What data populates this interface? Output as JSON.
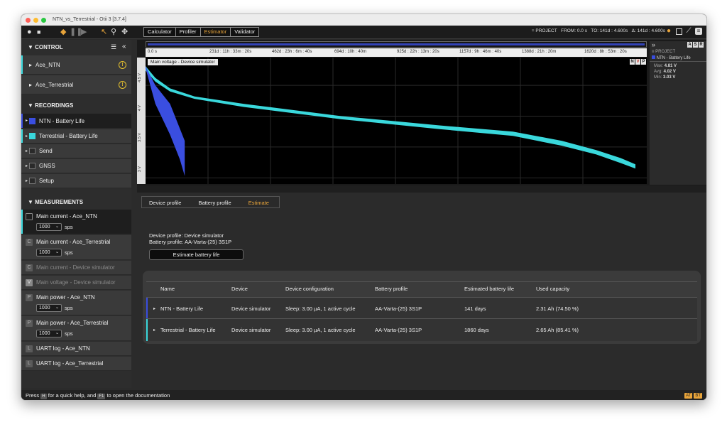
{
  "window": {
    "title": "NTN_vs_Terrestrial - Otii 3 [3.7.4]"
  },
  "toolbar": {
    "tabs": [
      "Calculator",
      "Profiler",
      "Estimator",
      "Validator"
    ],
    "active_tab": "Estimator",
    "project_label": "PROJECT",
    "from_label": "FROM: 0.0 s",
    "to_label": "TO: 141d : 4.600s",
    "delta_label": "Δ: 141d : 4.600s"
  },
  "sidebar": {
    "control_header": "CONTROL",
    "control_items": [
      {
        "label": "Ace_NTN",
        "status": "!"
      },
      {
        "label": "Ace_Terrestrial",
        "status": "!"
      }
    ],
    "recordings_header": "RECORDINGS",
    "recordings": [
      {
        "label": "NTN - Battery Life",
        "color": "#3a4ee0"
      },
      {
        "label": "Terrestrial - Battery Life",
        "color": "#3ad8dc"
      },
      {
        "label": "Send",
        "color": "#2a2a2a"
      },
      {
        "label": "GNSS",
        "color": "#2a2a2a"
      },
      {
        "label": "Setup",
        "color": "#2a2a2a"
      }
    ],
    "measurements_header": "MEASUREMENTS",
    "measurements": [
      {
        "letter": "",
        "label": "Main current - Ace_NTN",
        "sps": "1000",
        "unit": "sps"
      },
      {
        "letter": "C",
        "label": "Main current - Ace_Terrestrial",
        "sps": "1000",
        "unit": "sps"
      },
      {
        "letter": "C",
        "label": "Main current - Device simulator"
      },
      {
        "letter": "V",
        "label": "Main voltage - Device simulator"
      },
      {
        "letter": "P",
        "label": "Main power - Ace_NTN",
        "sps": "1000",
        "unit": "sps"
      },
      {
        "letter": "P",
        "label": "Main power - Ace_Terrestrial",
        "sps": "1000",
        "unit": "sps"
      },
      {
        "letter": "L",
        "label": "UART log - Ace_NTN"
      },
      {
        "letter": "L",
        "label": "UART log - Ace_Terrestrial"
      }
    ]
  },
  "graph": {
    "time_ticks": [
      "0.0 s",
      "231d : 11h : 33m : 20s",
      "462d : 23h : 6m : 40s",
      "694d : 10h : 40m",
      "925d : 22h : 13m : 20s",
      "1157d : 9h : 46m : 40s",
      "1388d : 21h : 20m",
      "1620d : 8h : 53m : 20s"
    ],
    "y_ticks": [
      "4.5 V",
      "4 V",
      "3.5 V",
      "3 V"
    ],
    "chart_label": "Main voltage - Device simulator",
    "nvp": [
      "N",
      "V",
      "P"
    ],
    "asr": [
      "A",
      "S",
      "R"
    ],
    "legend": {
      "project_label": "PROJECT",
      "series_label": "NTN - Battery Life",
      "stats": [
        {
          "label": "Max:",
          "value": "4.81 V"
        },
        {
          "label": "Avg:",
          "value": "4.02 V"
        },
        {
          "label": "Min:",
          "value": "3.03 V"
        }
      ]
    },
    "colors": {
      "ntn": "#3a4ee0",
      "terrestrial": "#3ad8dc"
    },
    "chart_data": {
      "type": "area",
      "ylim": [
        2.9,
        4.95
      ],
      "y_ticks": [
        4.5,
        4,
        3.5,
        3
      ],
      "series": [
        {
          "name": "NTN - Battery Life",
          "x": [
            0,
            0.02,
            0.05,
            0.07,
            0.08
          ],
          "y_upper": [
            4.81,
            4.5,
            4.2,
            3.8,
            3.6
          ],
          "y_lower": [
            4.78,
            4.2,
            3.7,
            3.3,
            3.03
          ]
        },
        {
          "name": "Terrestrial - Battery Life",
          "x": [
            0,
            0.02,
            0.05,
            0.1,
            0.2,
            0.4,
            0.6,
            0.75,
            0.85,
            0.92,
            0.97,
            1.0
          ],
          "y_upper": [
            4.81,
            4.62,
            4.45,
            4.32,
            4.2,
            4.0,
            3.85,
            3.75,
            3.6,
            3.45,
            3.32,
            3.22
          ],
          "y_lower": [
            4.74,
            4.56,
            4.4,
            4.28,
            4.15,
            3.95,
            3.79,
            3.68,
            3.52,
            3.38,
            3.24,
            3.15
          ]
        }
      ]
    }
  },
  "estimator": {
    "crumbs": [
      "Device profile",
      "Battery profile",
      "Estimate"
    ],
    "active_crumb": "Estimate",
    "device_profile_line": "Device profile:   Device simulator",
    "battery_profile_line": "Battery profile:   AA-Varta-(25) 3S1P",
    "estimate_button": "Estimate battery life",
    "table": {
      "headers": [
        "Name",
        "Device",
        "Device configuration",
        "Battery profile",
        "Estimated battery life",
        "Used capacity"
      ],
      "rows": [
        {
          "name": "NTN - Battery Life",
          "device": "Device simulator",
          "config": "Sleep: 3.00 µA, 1 active cycle",
          "battery": "AA-Varta-(25) 3S1P",
          "life": "141 days",
          "capacity": "2.31 Ah (74.50 %)",
          "accent": "#3a4ee0"
        },
        {
          "name": "Terrestrial - Battery Life",
          "device": "Device simulator",
          "config": "Sleep: 3.00 µA, 1 active cycle",
          "battery": "AA-Varta-(25) 3S1P",
          "life": "1860 days",
          "capacity": "2.65 Ah (85.41 %)",
          "accent": "#3ad8dc"
        }
      ]
    }
  },
  "statusbar": {
    "prefix": "Press",
    "key1": "H",
    "middle": "for a quick help, and",
    "key2": "F1",
    "suffix": "to open the documentation",
    "right_badges": [
      "AT",
      "BT"
    ]
  }
}
